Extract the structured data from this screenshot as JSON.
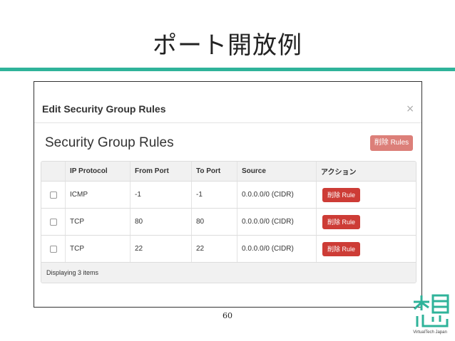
{
  "slide": {
    "title": "ポート開放例",
    "page_number": "60",
    "accent_color": "#2fb39a"
  },
  "modal": {
    "title": "Edit Security Group Rules",
    "close_symbol": "×"
  },
  "section": {
    "title": "Security Group Rules",
    "delete_rules_label": "削除 Rules"
  },
  "table": {
    "headers": [
      "IP Protocol",
      "From Port",
      "To Port",
      "Source",
      "アクション"
    ],
    "rows": [
      {
        "protocol": "ICMP",
        "from_port": "-1",
        "to_port": "-1",
        "source": "0.0.0.0/0 (CIDR)",
        "action": "削除 Rule"
      },
      {
        "protocol": "TCP",
        "from_port": "80",
        "to_port": "80",
        "source": "0.0.0.0/0 (CIDR)",
        "action": "削除 Rule"
      },
      {
        "protocol": "TCP",
        "from_port": "22",
        "to_port": "22",
        "source": "0.0.0.0/0 (CIDR)",
        "action": "削除 Rule"
      }
    ],
    "footer": "Displaying 3 items"
  },
  "logo": {
    "caption": "VirtualTech Japan",
    "icon_name": "virtualtech-logo-icon",
    "color": "#2fb39a"
  }
}
